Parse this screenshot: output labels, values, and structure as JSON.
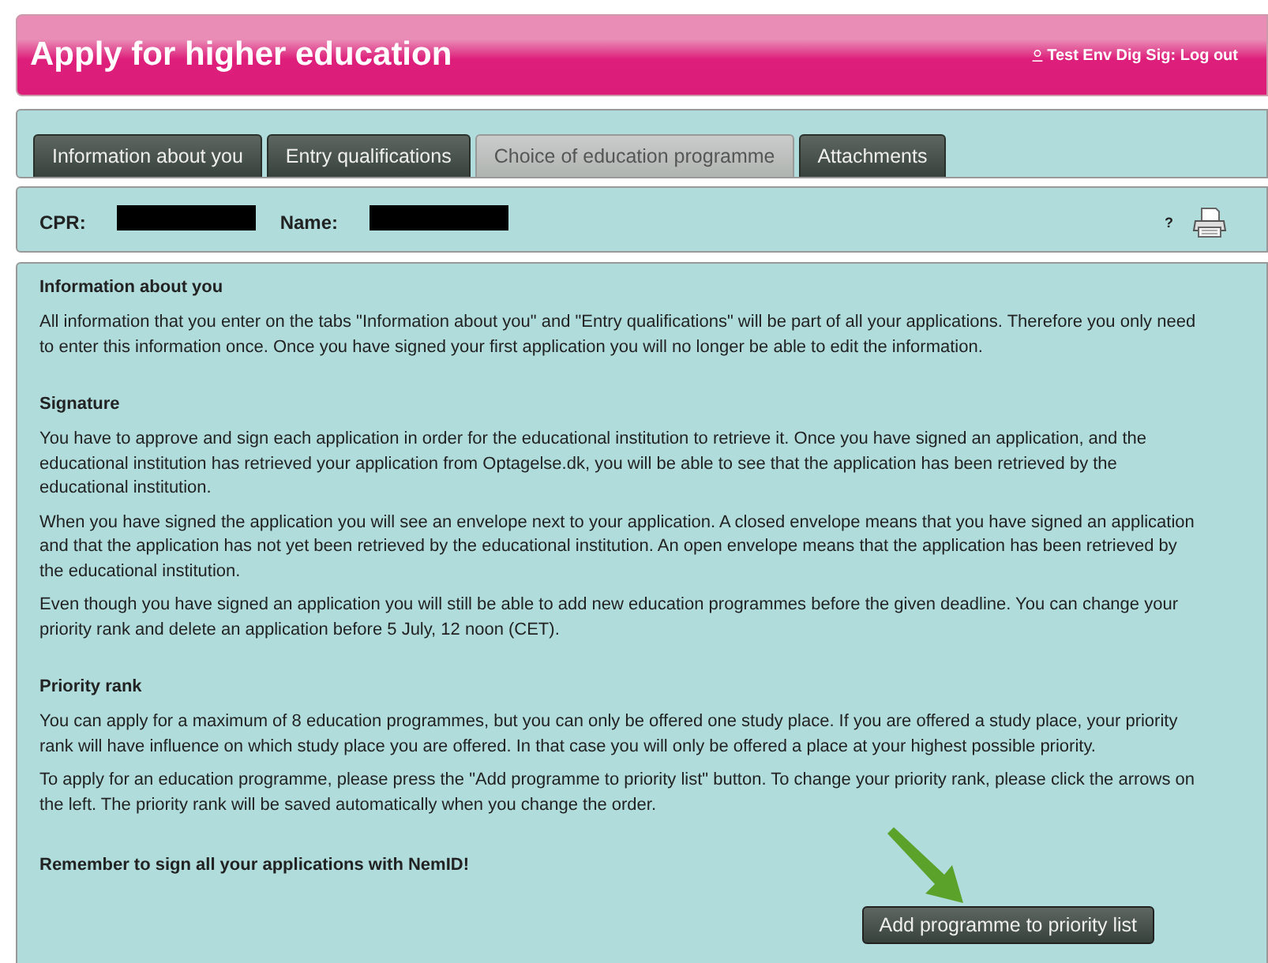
{
  "header": {
    "title": "Apply for higher education",
    "user_link": "Test Env Dig Sig: Log out"
  },
  "tabs": [
    {
      "label": "Information about you",
      "selected": false
    },
    {
      "label": "Entry qualifications",
      "selected": false
    },
    {
      "label": "Choice of education programme",
      "selected": true
    },
    {
      "label": "Attachments",
      "selected": false
    }
  ],
  "person": {
    "fields": [
      {
        "label": "CPR:",
        "redacted": true
      },
      {
        "label": "Name:",
        "redacted": true
      }
    ],
    "help": "?"
  },
  "sections": [
    {
      "heading": "Information about you",
      "paragraphs": [
        "All information that you enter on the tabs \"Information about you\" and \"Entry qualifications\" will be part of all your applications. Therefore you only need to enter this information once. Once you have signed your first application you will no longer be able to edit the information."
      ]
    },
    {
      "heading": "Signature",
      "paragraphs": [
        "You have to approve and sign each application in order for the educational institution to retrieve it. Once you have signed an application, and the educational institution has retrieved your application from Optagelse.dk, you will be able to see that the application has been retrieved by the educational institution.",
        "When you have signed the application you will see an envelope next to your application. A closed envelope means that you have signed an application and that the application has not yet been retrieved by the educational institution. An open envelope means that the application has been retrieved by the educational institution.",
        "Even though you have signed an application you will still be able to add new education programmes before the given deadline. You can change your priority rank and delete an application before 5 July, 12 noon (CET)."
      ]
    },
    {
      "heading": "Priority rank",
      "paragraphs": [
        "You can apply for a maximum of 8 education programmes, but you can only be offered one study place. If you are offered a study place, your priority rank will have influence on which study place you are offered. In that case you will only be offered a place at your highest possible priority.",
        "To apply for an education programme, please press the \"Add programme to priority list\" button. To change your priority rank, please click the arrows on the left. The priority rank will be saved automatically when you change the order."
      ]
    }
  ],
  "reminder": "Remember to sign all your applications with NemID!",
  "add_button": "Add programme to priority list"
}
